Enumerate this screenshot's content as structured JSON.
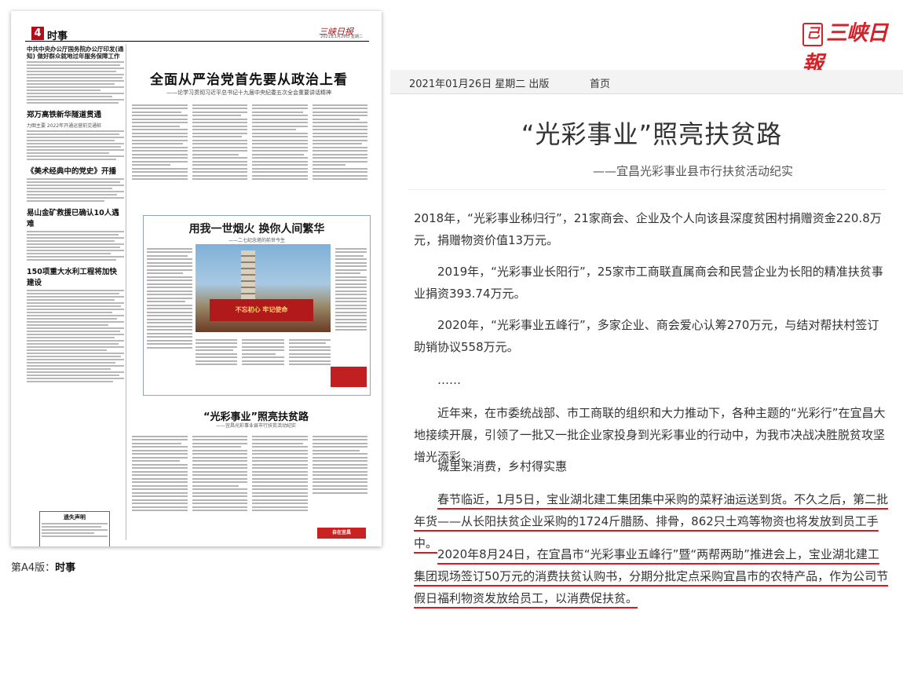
{
  "newspaper_page": {
    "page_number": "4",
    "section": "时事",
    "logo_text": "三峡日报",
    "header_date": "2021年1月26日  星期二",
    "left_column": {
      "articles": [
        {
          "title": "中共中央办公厅国务院办公厅印发(通知) 做好群众就地过年服务保障工作"
        },
        {
          "title": "郑万高铁新华隧道贯通",
          "sub": "力图主要 2022年开通运营前交通桩"
        },
        {
          "title": "《美术经典中的党史》开播"
        },
        {
          "title": "易山金矿救援已确认10人遇难"
        },
        {
          "title": "150项重大水利工程将加快建设"
        }
      ],
      "notice_title": "遗失声明"
    },
    "main_headline": "全面从严治党首先要从政治上看",
    "main_subheadline": "——论学习贯彻习近平总书记十九届中央纪委五次全会重要讲话精神",
    "boxed_story": {
      "headline": "用我一世烟火  换你人间繁华",
      "subheadline": "——二七纪念塔的前世今生",
      "banner_text": "不忘初心 牢记使命"
    },
    "second_story": {
      "headline": "“光彩事业”照亮扶贫路",
      "subheadline": "——宜昌光彩事业县市行扶贫活动纪实"
    },
    "ad_text": "自在宜昌"
  },
  "page_caption": {
    "prefix": "第A4版：",
    "name": "时事"
  },
  "site_logo": {
    "seal": "己",
    "text": "三峡日報"
  },
  "date_bar": {
    "date": "2021年01月26日  星期二  出版",
    "home": "首页"
  },
  "article": {
    "title": "“光彩事业”照亮扶贫路",
    "subtitle": "——宜昌光彩事业县市行扶贫活动纪实",
    "paragraphs": [
      "2018年，“光彩事业秭归行”，21家商会、企业及个人向该县深度贫困村捐赠资金220.8万元，捐赠物资价值13万元。",
      "2019年，“光彩事业长阳行”，25家市工商联直属商会和民营企业为长阳的精准扶贫事业捐资393.74万元。",
      "2020年，“光彩事业五峰行”，多家企业、商会爱心认筹270万元，与结对帮扶村签订助销协议558万元。",
      "……",
      "近年来，在市委统战部、市工商联的组织和大力推动下，各种主题的“光彩行”在宜昌大地接续开展，引领了一批又一批企业家投身到光彩事业的行动中，为我市决战决胜脱贫攻坚增光添彩。",
      "城里来消费，乡村得实惠",
      "春节临近，1月5日，宝业湖北建工集团集中采购的菜籽油运送到货。不久之后，第二批年货——从长阳扶贫企业采购的1724斤腊肠、排骨，862只土鸡等物资也将发放到员工手中。",
      "2020年8月24日，在宜昌市“光彩事业五峰行”暨“两帮两助”推进会上，宝业湖北建工集团现场签订50万元的消费扶贫认购书，分期分批定点采购宜昌市的农特产品，作为公司节假日福利物资发放给员工，以消费促扶贫。"
    ],
    "highlight_color": "#e8141c"
  }
}
